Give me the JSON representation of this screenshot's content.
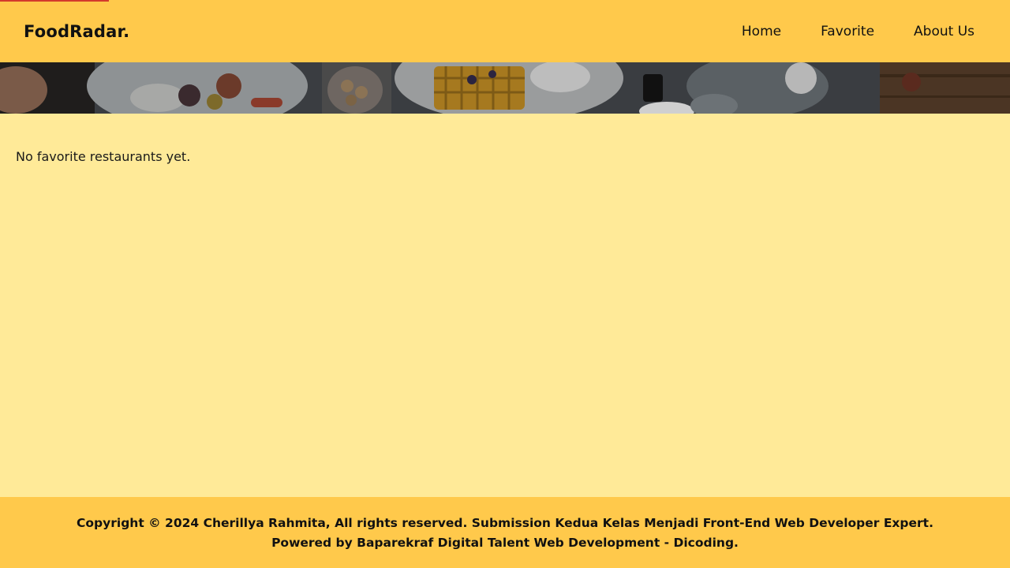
{
  "header": {
    "brand": "FoodRadar.",
    "nav": [
      {
        "label": "Home"
      },
      {
        "label": "Favorite"
      },
      {
        "label": "About Us"
      }
    ]
  },
  "hero": {
    "image": "restaurant-table-hero-image"
  },
  "main": {
    "empty_message": "No favorite restaurants yet."
  },
  "footer": {
    "line1": "Copyright © 2024 Cherillya Rahmita, All rights reserved. Submission Kedua Kelas Menjadi Front-End Web Developer Expert.",
    "line2": "Powered by Baparekraf Digital Talent Web Development - Dicoding."
  },
  "colors": {
    "header_bg": "#ffc94b",
    "page_bg": "#ffea98",
    "footer_bg": "#ffc94b",
    "progress_bar": "#d33a2c"
  }
}
